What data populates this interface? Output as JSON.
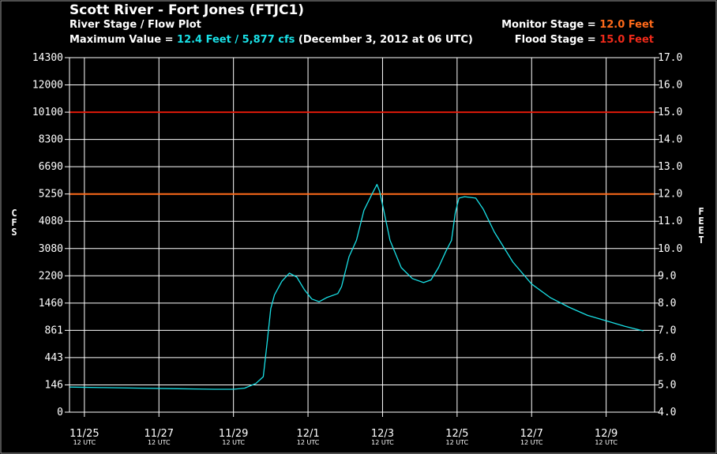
{
  "header": {
    "title": "Scott River - Fort Jones (FTJC1)",
    "subtitle": "River Stage / Flow Plot",
    "max_prefix": "Maximum Value = ",
    "max_value": "12.4 Feet / 5,877 cfs",
    "max_suffix": " (December 3, 2012 at 06 UTC)",
    "monitor_prefix": "Monitor Stage = ",
    "monitor_value": "12.0 Feet",
    "flood_prefix": "Flood Stage = ",
    "flood_value": "15.0 Feet"
  },
  "colors": {
    "background": "#000000",
    "grid": "#ffffff",
    "series": "#19e0e6",
    "monitor": "#ff6a1a",
    "flood": "#e01a0a"
  },
  "chart_data": {
    "type": "line",
    "title": "Scott River - Fort Jones (FTJC1)",
    "subtitle": "River Stage / Flow Plot",
    "ylabel_left": "CFS",
    "ylabel_right": "FEET",
    "grid": true,
    "y_range_feet": [
      4.0,
      17.0
    ],
    "y_ticks_feet": [
      "4.0",
      "5.0",
      "6.0",
      "7.0",
      "8.0",
      "9.0",
      "10.0",
      "11.0",
      "12.0",
      "13.0",
      "14.0",
      "15.0",
      "16.0",
      "17.0"
    ],
    "y_ticks_cfs": [
      "0",
      "146",
      "443",
      "861",
      "1460",
      "2200",
      "3080",
      "4080",
      "5250",
      "6690",
      "8300",
      "10100",
      "12000",
      "14300"
    ],
    "x_range_days": [
      -0.4,
      15.3
    ],
    "x_ticks": [
      {
        "day": 0,
        "label": "11/25",
        "sub": "12 UTC"
      },
      {
        "day": 2,
        "label": "11/27",
        "sub": "12 UTC"
      },
      {
        "day": 4,
        "label": "11/29",
        "sub": "12 UTC"
      },
      {
        "day": 6,
        "label": "12/1",
        "sub": "12 UTC"
      },
      {
        "day": 8,
        "label": "12/3",
        "sub": "12 UTC"
      },
      {
        "day": 10,
        "label": "12/5",
        "sub": "12 UTC"
      },
      {
        "day": 12,
        "label": "12/7",
        "sub": "12 UTC"
      },
      {
        "day": 14,
        "label": "12/9",
        "sub": "12 UTC"
      }
    ],
    "thresholds": [
      {
        "name": "Monitor Stage",
        "feet": 12.0
      },
      {
        "name": "Flood Stage",
        "feet": 15.0
      }
    ],
    "series": [
      {
        "units": "feet",
        "points": [
          [
            -0.4,
            4.92
          ],
          [
            0.5,
            4.9
          ],
          [
            1.5,
            4.88
          ],
          [
            2.5,
            4.86
          ],
          [
            3.5,
            4.84
          ],
          [
            4.0,
            4.84
          ],
          [
            4.3,
            4.88
          ],
          [
            4.6,
            5.05
          ],
          [
            4.8,
            5.3
          ],
          [
            4.9,
            6.5
          ],
          [
            5.0,
            7.8
          ],
          [
            5.1,
            8.3
          ],
          [
            5.3,
            8.8
          ],
          [
            5.5,
            9.1
          ],
          [
            5.7,
            8.95
          ],
          [
            5.9,
            8.5
          ],
          [
            6.1,
            8.15
          ],
          [
            6.3,
            8.05
          ],
          [
            6.5,
            8.2
          ],
          [
            6.8,
            8.35
          ],
          [
            6.9,
            8.6
          ],
          [
            7.1,
            9.7
          ],
          [
            7.3,
            10.3
          ],
          [
            7.5,
            11.4
          ],
          [
            7.7,
            11.95
          ],
          [
            7.85,
            12.35
          ],
          [
            7.92,
            12.1
          ],
          [
            8.0,
            11.6
          ],
          [
            8.2,
            10.3
          ],
          [
            8.5,
            9.3
          ],
          [
            8.8,
            8.9
          ],
          [
            9.1,
            8.75
          ],
          [
            9.3,
            8.85
          ],
          [
            9.5,
            9.3
          ],
          [
            9.7,
            9.9
          ],
          [
            9.85,
            10.3
          ],
          [
            9.95,
            11.3
          ],
          [
            10.05,
            11.85
          ],
          [
            10.2,
            11.9
          ],
          [
            10.5,
            11.85
          ],
          [
            10.7,
            11.45
          ],
          [
            11.0,
            10.6
          ],
          [
            11.5,
            9.5
          ],
          [
            12.0,
            8.7
          ],
          [
            12.5,
            8.2
          ],
          [
            13.0,
            7.85
          ],
          [
            13.5,
            7.55
          ],
          [
            14.0,
            7.35
          ],
          [
            14.5,
            7.15
          ],
          [
            15.0,
            6.98
          ]
        ]
      }
    ]
  }
}
